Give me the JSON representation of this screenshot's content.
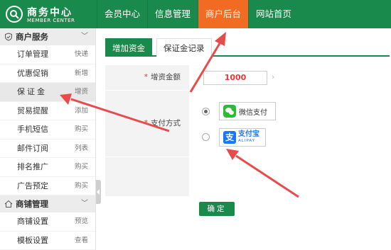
{
  "brand": {
    "title": "商务中心",
    "subtitle": "MEMBER CENTER"
  },
  "nav": {
    "items": [
      {
        "label": "会员中心"
      },
      {
        "label": "信息管理"
      },
      {
        "label": "商户后台"
      },
      {
        "label": "网站首页"
      }
    ],
    "active_index": 2
  },
  "sidebar": {
    "sections": [
      {
        "title": "商户服务",
        "items": [
          {
            "label": "订单管理",
            "tag": "快递"
          },
          {
            "label": "优惠促销",
            "tag": "新增"
          },
          {
            "label": "保证金",
            "tag": "增资"
          },
          {
            "label": "贸易提醒",
            "tag": "添加"
          },
          {
            "label": "手机短信",
            "tag": "购买"
          },
          {
            "label": "邮件订阅",
            "tag": "列表"
          },
          {
            "label": "排名推广",
            "tag": "购买"
          },
          {
            "label": "广告预定",
            "tag": "购买"
          }
        ]
      },
      {
        "title": "商铺管理",
        "items": [
          {
            "label": "商铺设置",
            "tag": "预览"
          },
          {
            "label": "模板设置",
            "tag": "查看"
          }
        ]
      }
    ],
    "active_item": "保证金"
  },
  "tabs": [
    {
      "label": "增加资金"
    },
    {
      "label": "保证金记录"
    }
  ],
  "form": {
    "amount_label": "增资金额",
    "amount_value": "1000",
    "amount_suffix": "›",
    "payment_label": "支付方式",
    "required_mark": "*",
    "payment_options": [
      {
        "label": "微信支付",
        "selected": true
      },
      {
        "label": "支付宝",
        "sublabel": "ALIPAY",
        "logo_char": "支",
        "selected": false
      }
    ],
    "confirm_label": "确定"
  },
  "colors": {
    "brand_green": "#1a8a4c",
    "active_orange": "#f26b22",
    "arrow_red": "#e84b4b",
    "alipay_blue": "#1677ff",
    "wechat_green": "#2dbb35"
  }
}
